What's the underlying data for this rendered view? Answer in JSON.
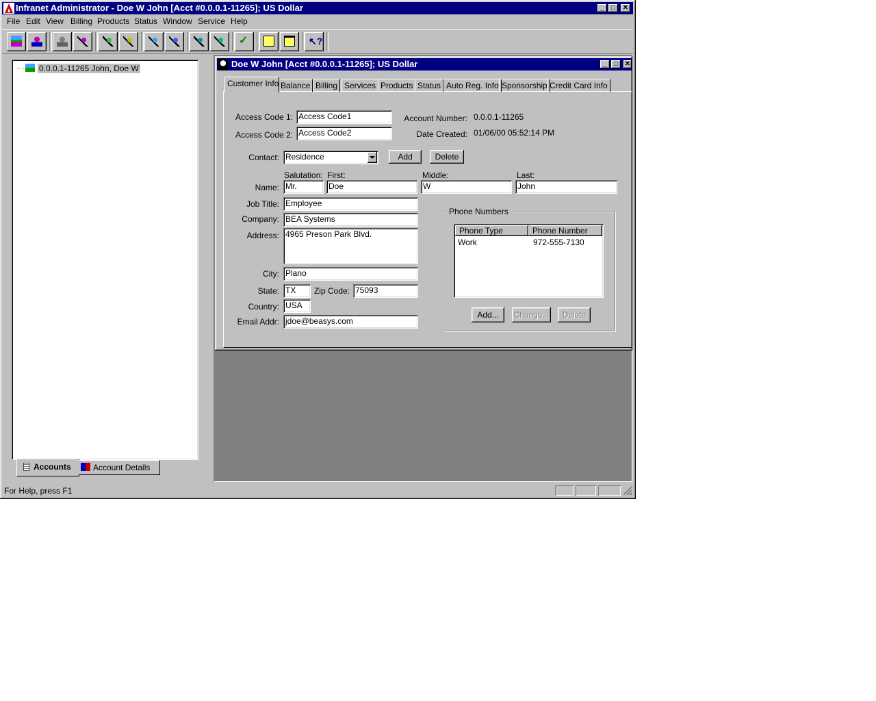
{
  "window": {
    "title": "Infranet Administrator - Doe W John [Acct #0.0.0.1-11265]; US Dollar"
  },
  "menu": [
    "File",
    "Edit",
    "View",
    "Billing",
    "Products",
    "Status",
    "Window",
    "Service",
    "Help"
  ],
  "toolbar": {
    "icons": [
      "new-account-icon",
      "customer-icon",
      "account-gray-icon",
      "search-account-icon",
      "find-icon",
      "find-next-icon",
      "search-service-icon",
      "search-product-icon",
      "search-bill-icon",
      "search-event-icon",
      "check-icon",
      "edit-note-icon",
      "note-icon",
      "context-help-icon"
    ]
  },
  "tree": {
    "item_label": "0.0.0.1-11265 John, Doe W"
  },
  "bottom_tabs": {
    "accounts": "Accounts",
    "account_details": "Account Details"
  },
  "child": {
    "title": "Doe W John [Acct #0.0.0.1-11265]; US Dollar"
  },
  "tabs": [
    "Customer Info",
    "Balance",
    "Billing",
    "Services",
    "Products",
    "Status",
    "Auto Reg. Info",
    "Sponsorship",
    "Credit Card Info"
  ],
  "form": {
    "access_code_1_label": "Access Code 1:",
    "access_code_1": "Access Code1",
    "access_code_2_label": "Access Code 2:",
    "access_code_2": "Access Code2",
    "account_number_label": "Account Number:",
    "account_number": "0.0.0.1-11265",
    "date_created_label": "Date Created:",
    "date_created": "01/06/00 05:52:14 PM",
    "contact_label": "Contact:",
    "contact": "Residence",
    "add_label": "Add",
    "delete_label": "Delete",
    "salutation_label": "Salutation:",
    "first_label": "First:",
    "middle_label": "Middle:",
    "last_label": "Last:",
    "name_label": "Name:",
    "salutation": "Mr.",
    "first": "Doe",
    "middle": "W",
    "last": "John",
    "job_title_label": "Job Title:",
    "job_title": "Employee",
    "company_label": "Company:",
    "company": "BEA Systems",
    "address_label": "Address:",
    "address": "4965 Preson Park Blvd.",
    "city_label": "City:",
    "city": "Plano",
    "state_label": "State:",
    "state": "TX",
    "zip_label": "Zip Code:",
    "zip": "75093",
    "country_label": "Country:",
    "country": "USA",
    "email_label": "Email Addr:",
    "email": "jdoe@beasys.com"
  },
  "phone": {
    "group_label": "Phone Numbers",
    "col_type": "Phone Type",
    "col_number": "Phone Number",
    "rows": [
      {
        "type": "Work",
        "number": "972-555-7130"
      }
    ],
    "add_label": "Add...",
    "change_label": "Change...",
    "delete_label": "Delete"
  },
  "status": {
    "text": "For Help, press F1"
  }
}
